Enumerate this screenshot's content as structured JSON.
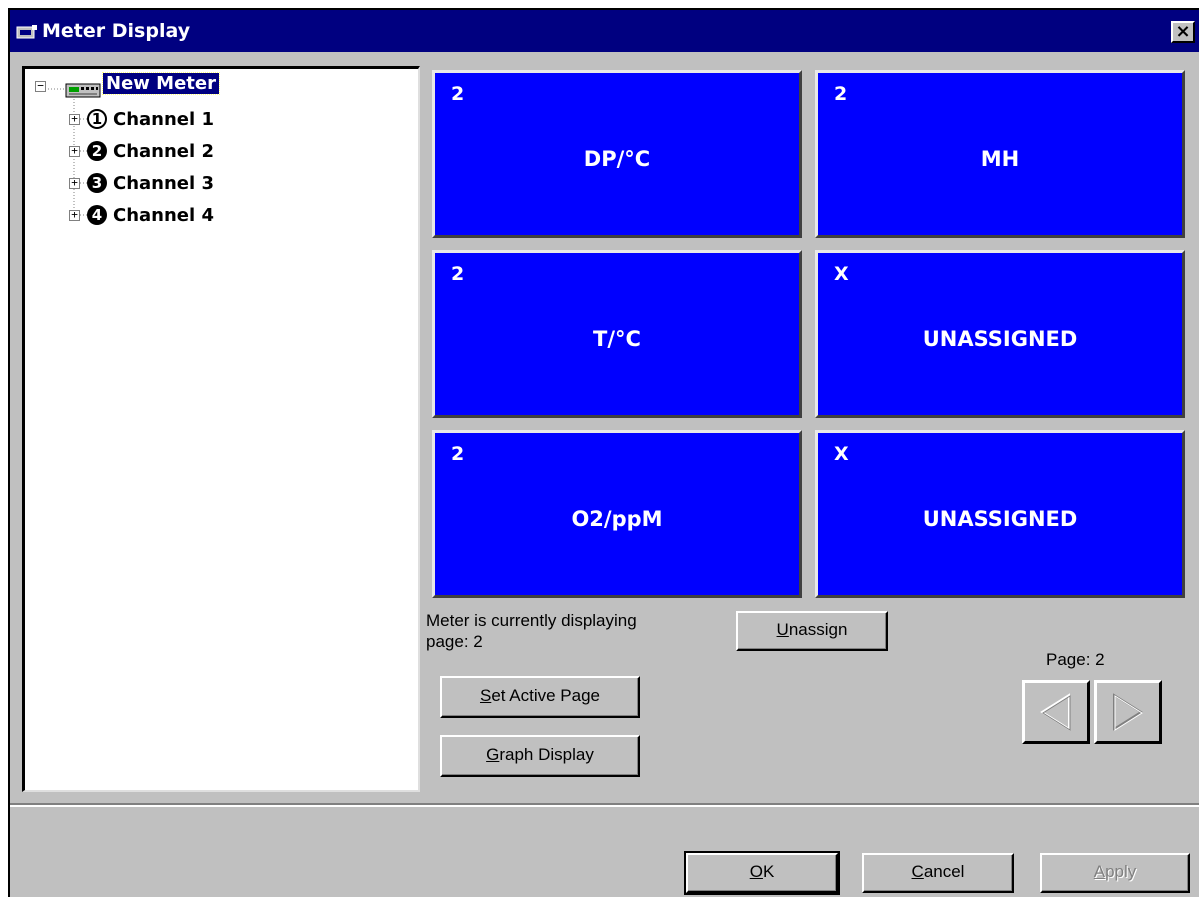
{
  "window": {
    "title": "Meter Display",
    "close_label": "×"
  },
  "tree": {
    "root_label": "New Meter",
    "channels": [
      {
        "number": "1",
        "label": "Channel 1"
      },
      {
        "number": "2",
        "label": "Channel 2"
      },
      {
        "number": "3",
        "label": "Channel 3"
      },
      {
        "number": "4",
        "label": "Channel 4"
      }
    ]
  },
  "tiles": [
    {
      "num": "2",
      "label": "DP/°C"
    },
    {
      "num": "2",
      "label": "MH"
    },
    {
      "num": "2",
      "label": "T/°C"
    },
    {
      "num": "X",
      "label": "UNASSIGNED"
    },
    {
      "num": "2",
      "label": "O2/ppM"
    },
    {
      "num": "X",
      "label": "UNASSIGNED"
    }
  ],
  "status": {
    "line1": "Meter is currently displaying",
    "line2": "page: 2"
  },
  "buttons": {
    "unassign": {
      "acc": "U",
      "rest": "nassign"
    },
    "set_active": {
      "acc": "S",
      "rest": "et Active Page"
    },
    "graph": {
      "acc": "G",
      "rest": "raph Display"
    },
    "ok": {
      "acc": "O",
      "rest": "K"
    },
    "cancel": {
      "acc": "C",
      "rest": "ancel"
    },
    "apply": {
      "acc": "A",
      "rest": "pply"
    }
  },
  "pager": {
    "label": "Page: 2"
  },
  "colors": {
    "tile": "#0000ff",
    "titlebar": "#000080",
    "face": "#c0c0c0"
  }
}
